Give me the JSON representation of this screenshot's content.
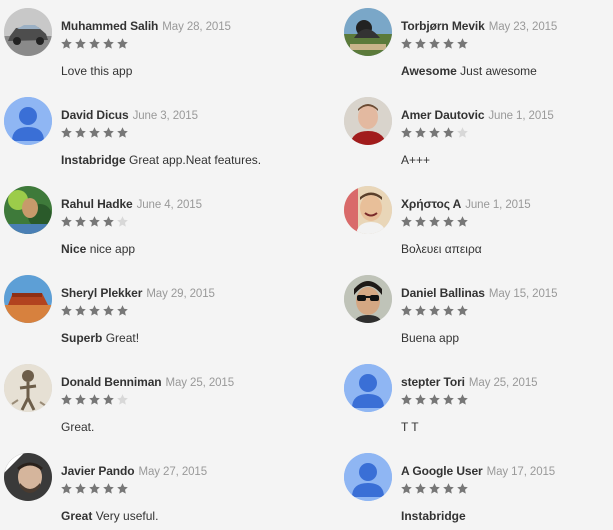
{
  "colors": {
    "background": "#f4f4f4",
    "star_filled": "#777777",
    "star_empty": "#d8d8d8",
    "default_avatar_bg": "#8fb6f3",
    "default_avatar_fg": "#3a6fd6"
  },
  "reviews": [
    {
      "author": "Muhammed Salih",
      "date": "May 28, 2015",
      "rating": 5,
      "title": "",
      "text": "Love this app",
      "avatar": "car-photo"
    },
    {
      "author": "Torbjørn Mevik",
      "date": "May 23, 2015",
      "rating": 5,
      "title": "Awesome",
      "text": "Just awesome",
      "avatar": "landscape-photo"
    },
    {
      "author": "David Dicus",
      "date": "June 3, 2015",
      "rating": 5,
      "title": "Instabridge",
      "text": "Great app.Neat features.",
      "avatar": "default-person-icon"
    },
    {
      "author": "Amer Dautovic",
      "date": "June 1, 2015",
      "rating": 4,
      "title": "",
      "text": "A+++",
      "avatar": "portrait-photo"
    },
    {
      "author": "Rahul Hadke",
      "date": "June 4, 2015",
      "rating": 4,
      "title": "Nice",
      "text": "nice app",
      "avatar": "nature-photo"
    },
    {
      "author": "Χρήστος Α",
      "date": "June 1, 2015",
      "rating": 5,
      "title": "",
      "text": "Βολευει απειρα",
      "avatar": "smiling-photo"
    },
    {
      "author": "Sheryl Plekker",
      "date": "May 29, 2015",
      "rating": 5,
      "title": "Superb",
      "text": "Great!",
      "avatar": "desert-photo"
    },
    {
      "author": "Daniel Ballinas",
      "date": "May 15, 2015",
      "rating": 5,
      "title": "",
      "text": "Buena app",
      "avatar": "sunglasses-photo"
    },
    {
      "author": "Donald Benniman",
      "date": "May 25, 2015",
      "rating": 4,
      "title": "",
      "text": "Great.",
      "avatar": "sketch-photo"
    },
    {
      "author": "stepter Tori",
      "date": "May 25, 2015",
      "rating": 5,
      "title": "",
      "text": "T T",
      "avatar": "default-person-icon"
    },
    {
      "author": "Javier Pando",
      "date": "May 27, 2015",
      "rating": 5,
      "title": "Great",
      "text": "Very useful.",
      "avatar": "man-photo"
    },
    {
      "author": "A Google User",
      "date": "May 17, 2015",
      "rating": 5,
      "title": "Instabridge",
      "text": "",
      "avatar": "default-person-icon"
    }
  ]
}
